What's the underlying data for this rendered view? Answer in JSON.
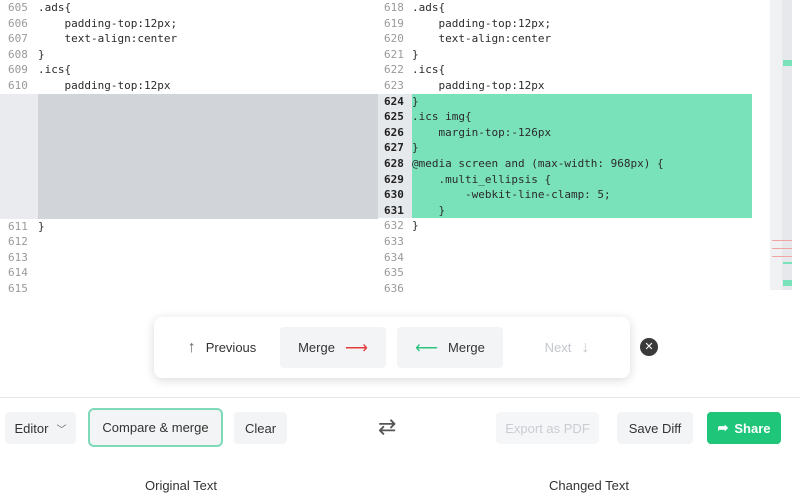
{
  "left_pane": {
    "lines_top": [
      {
        "num": "605",
        "code": ".ads{"
      },
      {
        "num": "606",
        "code": "    padding-top:12px;"
      },
      {
        "num": "607",
        "code": "    text-align:center"
      },
      {
        "num": "608",
        "code": "}"
      },
      {
        "num": "609",
        "code": ".ics{"
      },
      {
        "num": "610",
        "code": "    padding-top:12px"
      }
    ],
    "lines_bottom": [
      {
        "num": "611",
        "code": "}"
      },
      {
        "num": "612",
        "code": ""
      },
      {
        "num": "613",
        "code": ""
      },
      {
        "num": "614",
        "code": ""
      },
      {
        "num": "615",
        "code": ""
      }
    ]
  },
  "right_pane": {
    "lines_top": [
      {
        "num": "618",
        "code": ".ads{"
      },
      {
        "num": "619",
        "code": "    padding-top:12px;"
      },
      {
        "num": "620",
        "code": "    text-align:center"
      },
      {
        "num": "621",
        "code": "}"
      },
      {
        "num": "622",
        "code": ".ics{"
      },
      {
        "num": "623",
        "code": "    padding-top:12px"
      }
    ],
    "lines_added": [
      {
        "num": "624",
        "code": "}"
      },
      {
        "num": "625",
        "code": ".ics img{"
      },
      {
        "num": "626",
        "code": "    margin-top:-126px"
      },
      {
        "num": "627",
        "code": "}"
      },
      {
        "num": "628",
        "code": "@media screen and (max-width: 968px) {"
      },
      {
        "num": "629",
        "code": "    .multi_ellipsis {"
      },
      {
        "num": "630",
        "code": "        -webkit-line-clamp: 5;"
      },
      {
        "num": "631",
        "code": "    }"
      }
    ],
    "lines_bottom": [
      {
        "num": "632",
        "code": "}"
      },
      {
        "num": "633",
        "code": ""
      },
      {
        "num": "634",
        "code": ""
      },
      {
        "num": "635",
        "code": ""
      },
      {
        "num": "636",
        "code": ""
      }
    ]
  },
  "nav": {
    "previous": "Previous",
    "merge_right": "Merge",
    "merge_left": "Merge",
    "next": "Next",
    "close_glyph": "✕"
  },
  "toolbar": {
    "editor": "Editor",
    "compare_merge": "Compare & merge",
    "clear": "Clear",
    "export_pdf": "Export as PDF",
    "save_diff": "Save Diff",
    "share": "Share"
  },
  "footer": {
    "original": "Original Text",
    "changed": "Changed Text"
  },
  "colors": {
    "added_bg": "#79e2bb",
    "removed_placeholder": "#d1d4d9",
    "share_green": "#1fc67a",
    "merge_arrow_red": "#e53b3b",
    "merge_arrow_green": "#2ec27e"
  }
}
